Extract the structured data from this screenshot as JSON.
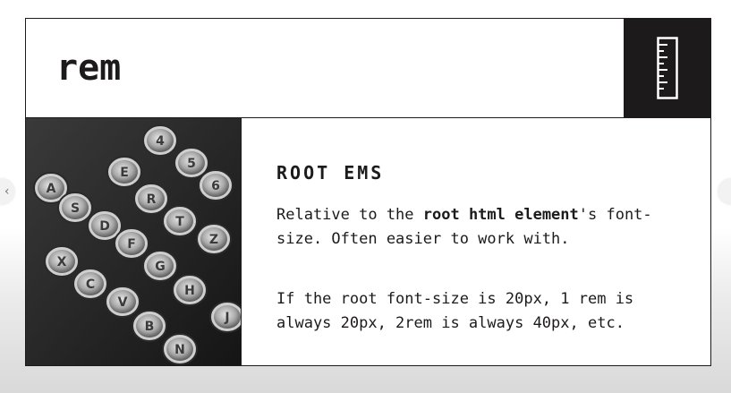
{
  "slide": {
    "title": "rem",
    "subtitle": "ROOT EMS",
    "paragraph1": {
      "prefix": "Relative to the ",
      "bold": "root html element",
      "suffix": "'s font-size. Often easier to work with."
    },
    "paragraph2": "If the root font-size is 20px, 1 rem is always 20px, 2rem is always 40px, etc.",
    "icon": "ruler-icon",
    "image": "typewriter-keys-photo"
  },
  "navigation": {
    "prev_icon": "chevron-left-icon",
    "prev_glyph": "‹",
    "next_icon": "chevron-right-icon"
  },
  "colors": {
    "ink": "#1d1a1b",
    "background": "#ffffff"
  },
  "typewriter_keys": [
    "4",
    "5",
    "6",
    "R",
    "T",
    "E",
    "A",
    "S",
    "D",
    "F",
    "G",
    "H",
    "Z",
    "J",
    "X",
    "C",
    "V",
    "B",
    "N"
  ]
}
